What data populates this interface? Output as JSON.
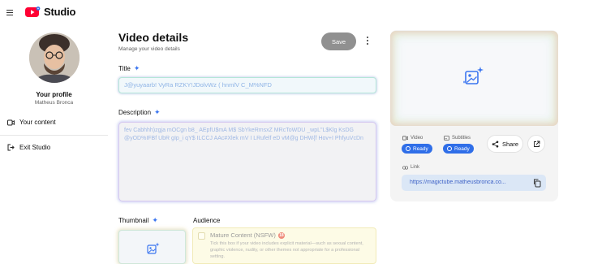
{
  "app": {
    "name": "Studio"
  },
  "sidebar": {
    "profile_title": "Your profile",
    "profile_name": "Matheus Bronca",
    "items": [
      {
        "label": "Your content",
        "icon": "video-icon"
      },
      {
        "label": "Exit Studio",
        "icon": "exit-icon"
      }
    ]
  },
  "main": {
    "title": "Video details",
    "subtitle": "Manage your video details",
    "save_label": "Save",
    "title_label": "Title",
    "title_value": "J@yuyaarb! VyRa RZKY!JDolvWz ( hnmlV C_M%NFD",
    "description_label": "Description",
    "description_value": "fev Cabhhh)zgja mOCgn b8_ AEpfU$mA M$ SbYkeRmsxZ MRcToWDU _wpL\"L$Klg KsDG @yOD%IFBf UbR gIp_i qY$ ILCCJ AAc#Xlek mV I LRufelf eD vM@g DHW{f Hov+I PhfyuVcDn",
    "thumbnail_label": "Thumbnail",
    "audience_label": "Audience",
    "nsfw_title": "Mature Content (NSFW)",
    "nsfw_description": "Tick this box if your video includes explicit material—such as sexual content, graphic violence, nudity, or other themes not appropriate for a professional setting."
  },
  "panel": {
    "video_label": "Video",
    "subtitles_label": "Subtitles",
    "video_status": "Ready",
    "subtitles_status": "Ready",
    "share_label": "Share",
    "link_label": "Link",
    "link_url": "https://magictube.matheusbronca.co..."
  },
  "colors": {
    "brand_red": "#ff0033",
    "accent_blue": "#2f6ee8",
    "save_disabled": "#909090"
  }
}
